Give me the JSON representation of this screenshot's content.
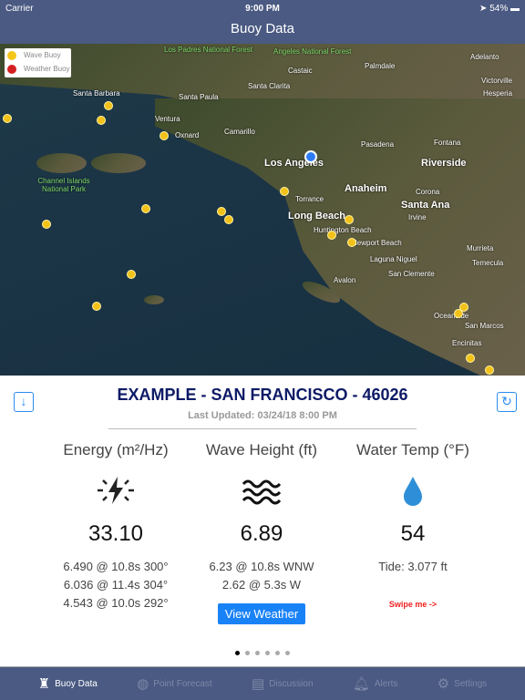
{
  "status": {
    "carrier": "Carrier",
    "time": "9:00 PM",
    "battery": "54%"
  },
  "nav": {
    "title": "Buoy Data"
  },
  "map": {
    "legend": [
      {
        "label": "Wave Buoy",
        "color": "#f5c518"
      },
      {
        "label": "Weather Buoy",
        "color": "#d42020"
      }
    ],
    "labels": {
      "lp": "Los Padres National Forest",
      "an": "Angeles National Forest",
      "castaic": "Castaic",
      "palmdale": "Palmdale",
      "adelanto": "Adelanto",
      "victorville": "Victorville",
      "sb": "Santa Barbara",
      "sp": "Santa Paula",
      "sc": "Santa Clarita",
      "ventura": "Ventura",
      "oxnard": "Oxnard",
      "camarillo": "Camarillo",
      "la": "Los Angeles",
      "pasadena": "Pasadena",
      "riverside": "Riverside",
      "anaheim": "Anaheim",
      "lb": "Long Beach",
      "sa": "Santa Ana",
      "ci": "Channel Islands National Park",
      "hb": "Huntington Beach",
      "np": "Newport Beach",
      "lagb": "Laguna Niguel",
      "scl": "San Clemente",
      "avalon": "Avalon",
      "ocean": "Oceanside",
      "encinitas": "Encinitas",
      "torrance": "Torrance",
      "hesperia": "Hesperia",
      "fontana": "Fontana",
      "corona": "Corona",
      "irvine": "Irvine",
      "temecula": "Temecula",
      "murrieta": "Murrieta",
      "sm": "San Marcos"
    }
  },
  "station": {
    "title": "EXAMPLE - SAN FRANCISCO - 46026",
    "updated": "Last Updated: 03/24/18 8:00 PM"
  },
  "columns": [
    {
      "header": "Energy (m²/Hz)",
      "icon": "energy-icon",
      "value": "33.10",
      "details": [
        "6.490 @ 10.8s 300°",
        "6.036 @ 11.4s 304°",
        "4.543 @ 10.0s 292°"
      ]
    },
    {
      "header": "Wave Height (ft)",
      "icon": "waves-icon",
      "value": "6.89",
      "details": [
        "6.23 @ 10.8s WNW",
        "2.62 @ 5.3s W"
      ],
      "button": "View Weather"
    },
    {
      "header": "Water Temp (°F)",
      "icon": "water-drop-icon",
      "value": "54",
      "details": [
        "Tide: 3.077 ft"
      ],
      "hint": "Swipe me ->"
    }
  ],
  "pager": {
    "pages": 6,
    "current": 1
  },
  "tabs": [
    {
      "label": "Buoy Data",
      "active": true
    },
    {
      "label": "Point Forecast"
    },
    {
      "label": "Discussion"
    },
    {
      "label": "Alerts"
    },
    {
      "label": "Settings"
    }
  ]
}
